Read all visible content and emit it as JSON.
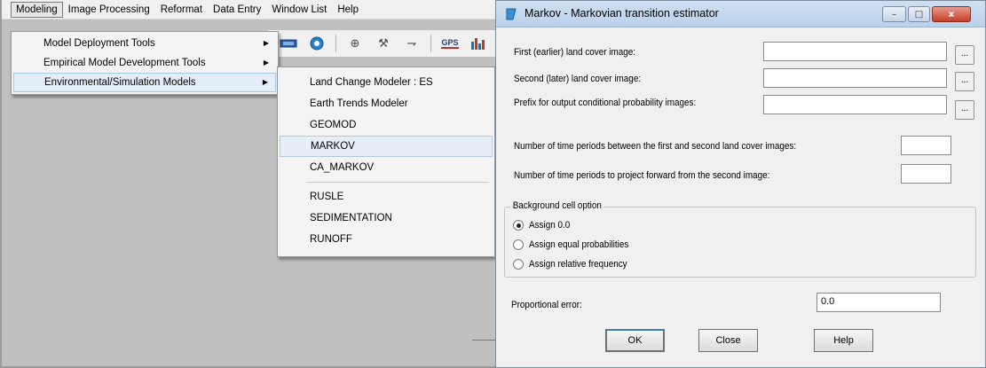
{
  "menubar": {
    "items": [
      "Modeling",
      "Image Processing",
      "Reformat",
      "Data Entry",
      "Window List",
      "Help"
    ]
  },
  "toolbar": {
    "icons": [
      "layer-icon",
      "globe-icon",
      "crosshair-icon",
      "tools-icon",
      "arrow-icon",
      "gps-icon",
      "chart-icon"
    ],
    "gps_label": "GPS"
  },
  "modeling_menu": {
    "items": [
      {
        "label": "Model Deployment Tools",
        "has_submenu": true
      },
      {
        "label": "Empirical Model Development Tools",
        "has_submenu": true
      },
      {
        "label": "Environmental/Simulation Models",
        "has_submenu": true
      }
    ]
  },
  "submenu": {
    "group1": [
      "Land Change Modeler : ES",
      "Earth Trends Modeler",
      "GEOMOD",
      "MARKOV",
      "CA_MARKOV"
    ],
    "group2": [
      "RUSLE",
      "SEDIMENTATION",
      "RUNOFF"
    ],
    "highlighted": "MARKOV"
  },
  "dialog": {
    "title": "Markov - Markovian transition estimator",
    "fields": {
      "first_image_label": "First (earlier) land cover image:",
      "first_image_value": "",
      "second_image_label": "Second (later) land cover image:",
      "second_image_value": "",
      "prefix_label": "Prefix for output conditional probability images:",
      "prefix_value": "",
      "browse_label": "...",
      "periods_between_label": "Number of time periods between the first and second land cover images:",
      "periods_between_value": "",
      "periods_forward_label": "Number of time periods to project forward from the second image:",
      "periods_forward_value": ""
    },
    "background_group": {
      "legend": "Background cell option",
      "options": [
        "Assign 0.0",
        "Assign equal probabilities",
        "Assign relative frequency"
      ],
      "selected": "Assign 0.0"
    },
    "proportional_error_label": "Proportional error:",
    "proportional_error_value": "0.0",
    "buttons": {
      "ok": "OK",
      "close": "Close",
      "help": "Help"
    },
    "window_controls": {
      "minimize": "–",
      "maximize": "□",
      "close": "x"
    }
  },
  "colors": {
    "title_gradient_top": "#cfe0f2",
    "title_gradient_bottom": "#b9d1ea",
    "close_button": "#c5402a",
    "menu_highlight": "#e3eef9"
  }
}
